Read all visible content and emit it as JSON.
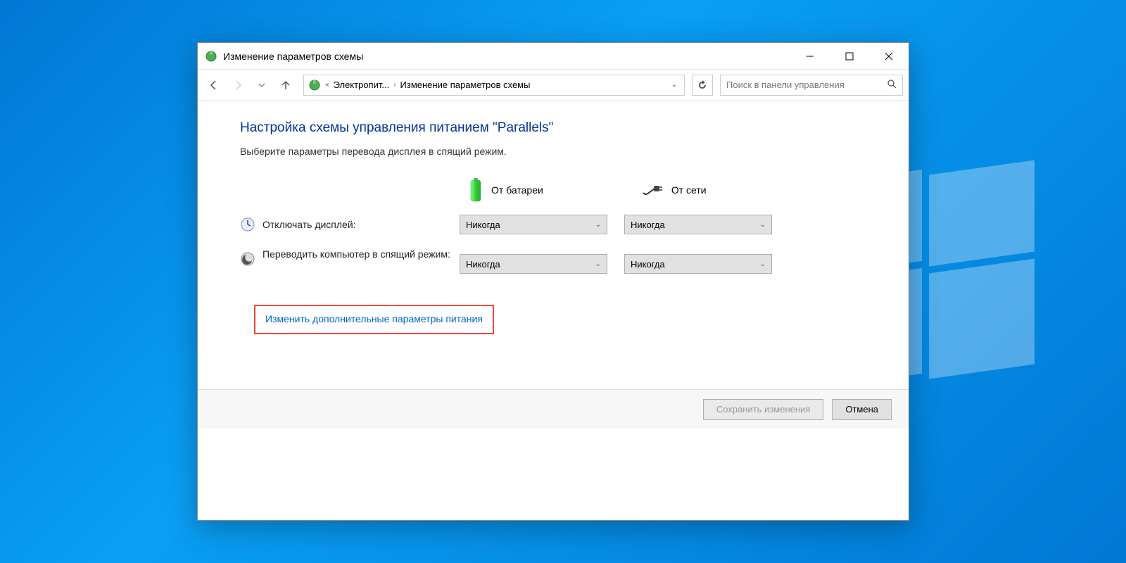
{
  "titlebar": {
    "title": "Изменение параметров схемы"
  },
  "breadcrumb": {
    "parent": "Электропит...",
    "current": "Изменение параметров схемы"
  },
  "search": {
    "placeholder": "Поиск в панели управления"
  },
  "page": {
    "heading": "Настройка схемы управления питанием \"Parallels\"",
    "subheading": "Выберите параметры перевода дисплея в спящий режим."
  },
  "columns": {
    "battery": "От батареи",
    "plugged": "От сети"
  },
  "settings": {
    "display_off": {
      "label": "Отключать дисплей:",
      "battery_value": "Никогда",
      "plugged_value": "Никогда"
    },
    "sleep": {
      "label": "Переводить компьютер в спящий режим:",
      "battery_value": "Никогда",
      "plugged_value": "Никогда"
    }
  },
  "link": {
    "advanced": "Изменить дополнительные параметры питания"
  },
  "buttons": {
    "save": "Сохранить изменения",
    "cancel": "Отмена"
  }
}
